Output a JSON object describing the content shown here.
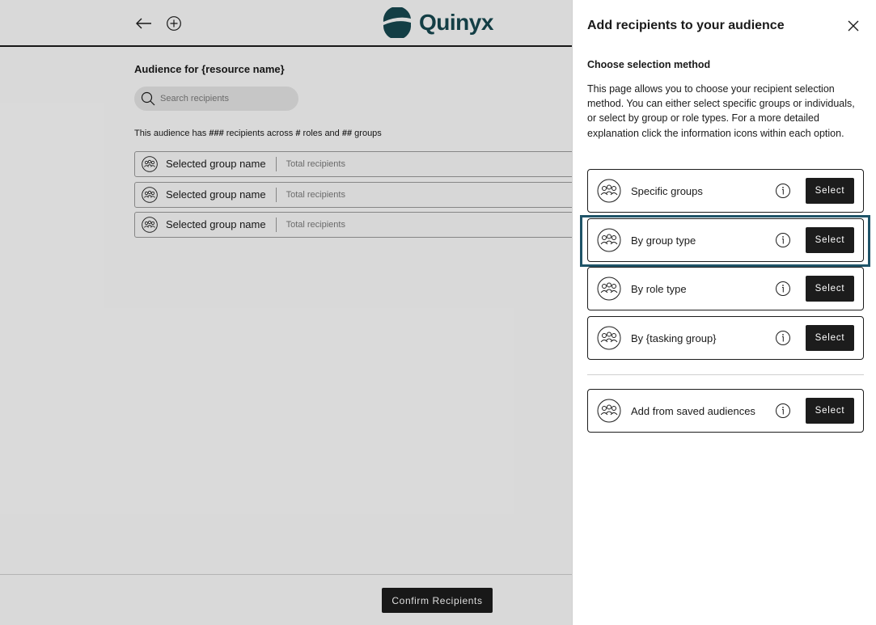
{
  "header": {
    "brand": "Quinyx"
  },
  "main": {
    "title": "Audience for {resource name}",
    "search_placeholder": "Search recipients",
    "summary": {
      "prefix": "This audience has ",
      "recipients": "###",
      "mid1": " recipients across ",
      "roles": "#",
      "mid2": " roles and ",
      "groups": "##",
      "suffix": " groups"
    },
    "groups": [
      {
        "name": "Selected group name",
        "total": "Total recipients"
      },
      {
        "name": "Selected group name",
        "total": "Total recipients"
      },
      {
        "name": "Selected group name",
        "total": "Total recipients"
      }
    ]
  },
  "footer": {
    "confirm_label": "Confirm Recipients"
  },
  "drawer": {
    "title": "Add recipients to your audience",
    "section_heading": "Choose selection method",
    "description": "This page allows you to choose your recipient selection method. You can either select specific groups or individuals, or select by group or role types. For a more detailed explanation click the information icons within each option.",
    "options": [
      {
        "label": "Specific groups",
        "button": "Select"
      },
      {
        "label": "By group type",
        "button": "Select"
      },
      {
        "label": "By role type",
        "button": "Select"
      },
      {
        "label": "By {tasking group}",
        "button": "Select"
      }
    ],
    "saved_option": {
      "label": "Add from saved audiences",
      "button": "Select"
    }
  },
  "colors": {
    "brand": "#164850",
    "highlight": "#1f5468",
    "button": "#1c1c1c"
  },
  "icons": [
    "back-arrow-icon",
    "add-circle-icon",
    "search-icon",
    "group-icon",
    "info-icon",
    "close-icon"
  ]
}
